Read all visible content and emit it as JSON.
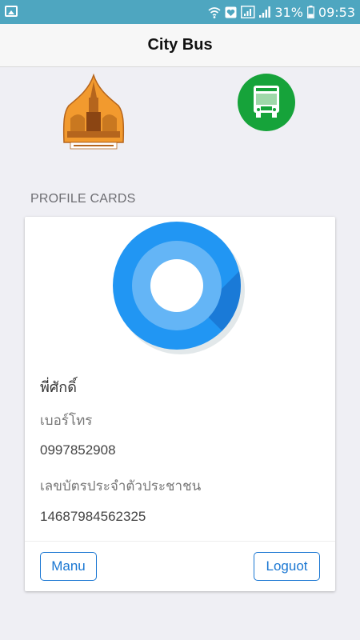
{
  "status_bar": {
    "battery_percent": "31%",
    "time": "09:53",
    "background": "#4ea6c0"
  },
  "header": {
    "title": "City Bus"
  },
  "logos": {
    "left": "university-logo",
    "right": "city-bus-logo"
  },
  "section": {
    "title": "PROFILE CARDS"
  },
  "profile": {
    "name": "พี่ศักดิ์",
    "phone_label": "เบอร์โทร",
    "phone": "0997852908",
    "id_label": "เลขบัตรประจำตัวประชาชน",
    "id_number": "14687984562325"
  },
  "actions": {
    "menu_label": "Manu",
    "logout_label": "Loguot"
  },
  "colors": {
    "accent": "#1976d2",
    "avatar_outer": "#2196f3",
    "avatar_ring": "#64b5f6",
    "logo_green": "#16a33a",
    "logo_orange": "#f29a2e"
  }
}
